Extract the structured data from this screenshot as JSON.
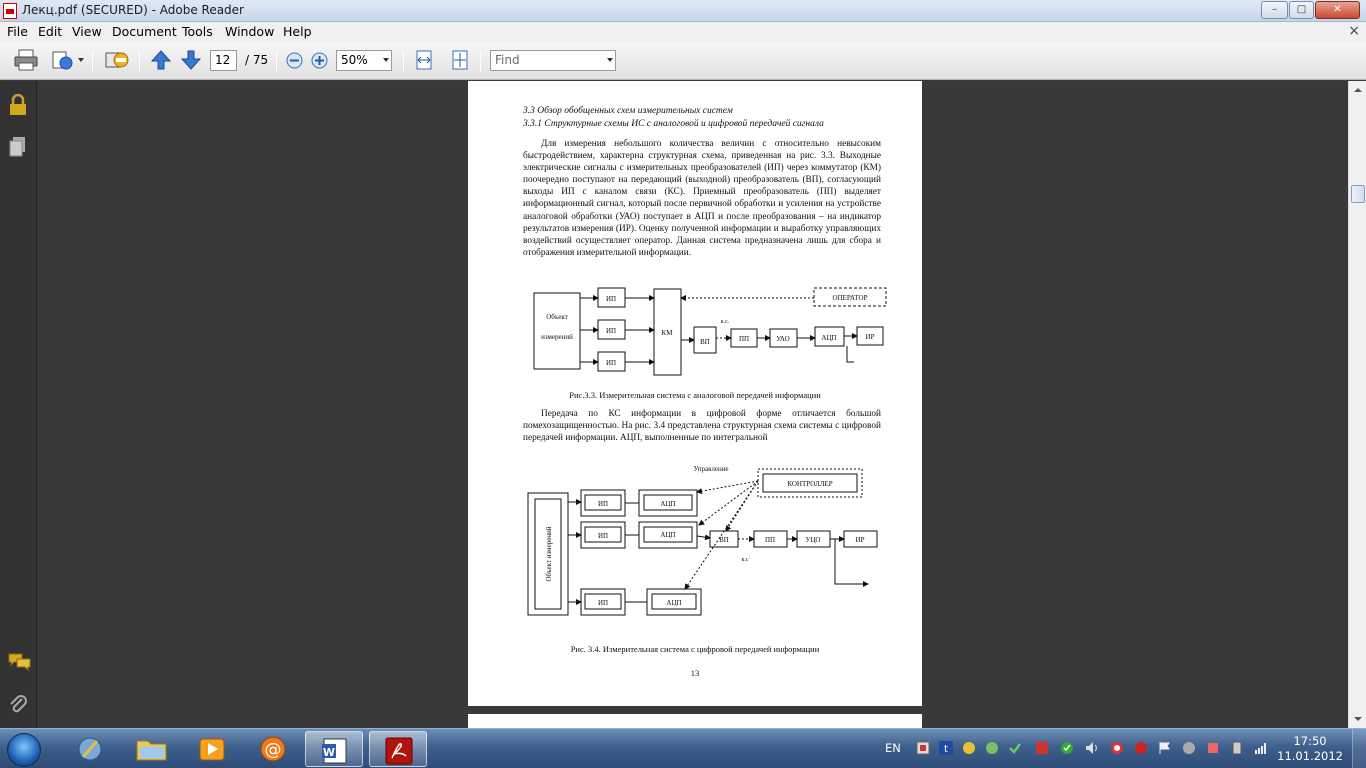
{
  "window": {
    "title": "Лекц.pdf (SECURED) - Adobe Reader",
    "minimize_label": "–",
    "maximize_label": "□",
    "close_label": "✕"
  },
  "menu": {
    "items": [
      "File",
      "Edit",
      "View",
      "Document",
      "Tools",
      "Window",
      "Help"
    ],
    "close_doc": "×"
  },
  "toolbar": {
    "page_current": "12",
    "page_total": "/ 75",
    "zoom": "50%",
    "find_placeholder": "Find"
  },
  "page": {
    "heading1": "3.3 Обзор обобщенных схем измерительных систем",
    "heading2": "3.3.1 Структурные схемы ИС с аналоговой и цифровой передачей сигнала",
    "para1": "Для измерения небольшого количества величин с относительно невысоким быстродействием, характерна структурная схема, приведенная на рис. 3.3. Выходные электрические сигналы с измерительных преобразователей (ИП) через коммутатор (КМ) поочередно поступают на передающий (выходной) преобразователь (ВП), согласующий выходы ИП с каналом связи (КС). Приемный преобразователь (ПП) выделяет информационный сигнал, который после первичной обработки и усиления на устройстве аналоговой обработки (УАО) поступает в АЦП и после преобразования – на индикатор результатов измерения (ИР). Оценку полученной информации и выработку управляющих воздействий осуществляет оператор. Данная система предназначена лишь для сбора и отображения измерительной информации.",
    "para2": "Передача по КС информации в цифровой форме отличается большой помехозащищенностью. На рис. 3.4 представлена структурная схема системы с цифровой передачей информации. АЦП, выполненные по интегральной",
    "caption1": "Рис.3.3.  Измерительная система с аналоговой передачей информации",
    "caption2": "Рис. 3.4. Измерительная система с цифровой передачей информации",
    "page_number": "13"
  },
  "diagram1": {
    "object_line1": "Объект",
    "object_line2": "измерений",
    "ip": "ИП",
    "km": "КМ",
    "vp": "ВП",
    "ks": "к.с.",
    "pp": "ПП",
    "uao": "УАО",
    "adc": "АЦП",
    "ir": "ИР",
    "operator": "ОПЕРАТОР"
  },
  "diagram2": {
    "control": "Управление",
    "controller": "КОНТРОЛЛЕР",
    "object": "Объект измерений",
    "ip": "ИП",
    "adc": "АЦП",
    "vp": "ВП",
    "ks": "к.с",
    "pp": "ПП",
    "ucho": "УЦО",
    "ir": "ИР"
  },
  "taskbar": {
    "lang": "EN",
    "time": "17:50",
    "date": "11.01.2012"
  }
}
